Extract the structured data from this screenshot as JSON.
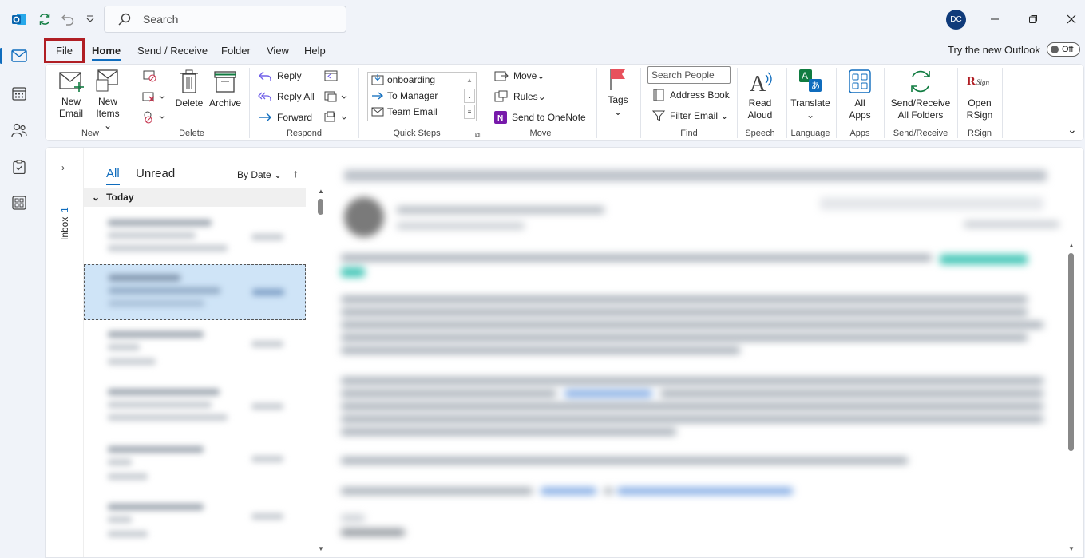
{
  "titlebar": {
    "search_placeholder": "Search",
    "avatar_initials": "DC"
  },
  "menu": {
    "tabs": [
      "File",
      "Home",
      "Send / Receive",
      "Folder",
      "View",
      "Help"
    ],
    "try_new_label": "Try the new Outlook",
    "toggle_label": "Off"
  },
  "ribbon": {
    "new": {
      "new_email": [
        "New",
        "Email"
      ],
      "new_items": [
        "New",
        "Items"
      ],
      "group": "New"
    },
    "delete": {
      "delete": "Delete",
      "archive": "Archive",
      "group": "Delete"
    },
    "respond": {
      "reply": "Reply",
      "reply_all": "Reply All",
      "forward": "Forward",
      "group": "Respond"
    },
    "quick_steps": {
      "items": [
        "onboarding",
        "To Manager",
        "Team Email"
      ],
      "group": "Quick Steps"
    },
    "move": {
      "move": "Move",
      "rules": "Rules",
      "onenote": "Send to OneNote",
      "group": "Move"
    },
    "tags": {
      "label": "Tags"
    },
    "find": {
      "search_people_placeholder": "Search People",
      "address_book": "Address Book",
      "filter_email": "Filter Email",
      "group": "Find"
    },
    "speech": {
      "read_aloud": [
        "Read",
        "Aloud"
      ],
      "group": "Speech"
    },
    "language": {
      "translate": "Translate",
      "group": "Language"
    },
    "apps": {
      "all_apps": [
        "All",
        "Apps"
      ],
      "group": "Apps"
    },
    "send_receive": {
      "label": [
        "Send/Receive",
        "All Folders"
      ],
      "group": "Send/Receive"
    },
    "rsign": {
      "label": [
        "Open",
        "RSign"
      ],
      "group": "RSign"
    }
  },
  "folder_strip": {
    "inbox_label": "Inbox",
    "inbox_count": "1"
  },
  "message_list": {
    "filters": [
      "All",
      "Unread"
    ],
    "sort_label": "By Date",
    "group_header": "Today"
  },
  "colors": {
    "accent": "#0f6cbd",
    "highlight_box": "#b01e24",
    "selected_row": "#cfe4f7"
  }
}
